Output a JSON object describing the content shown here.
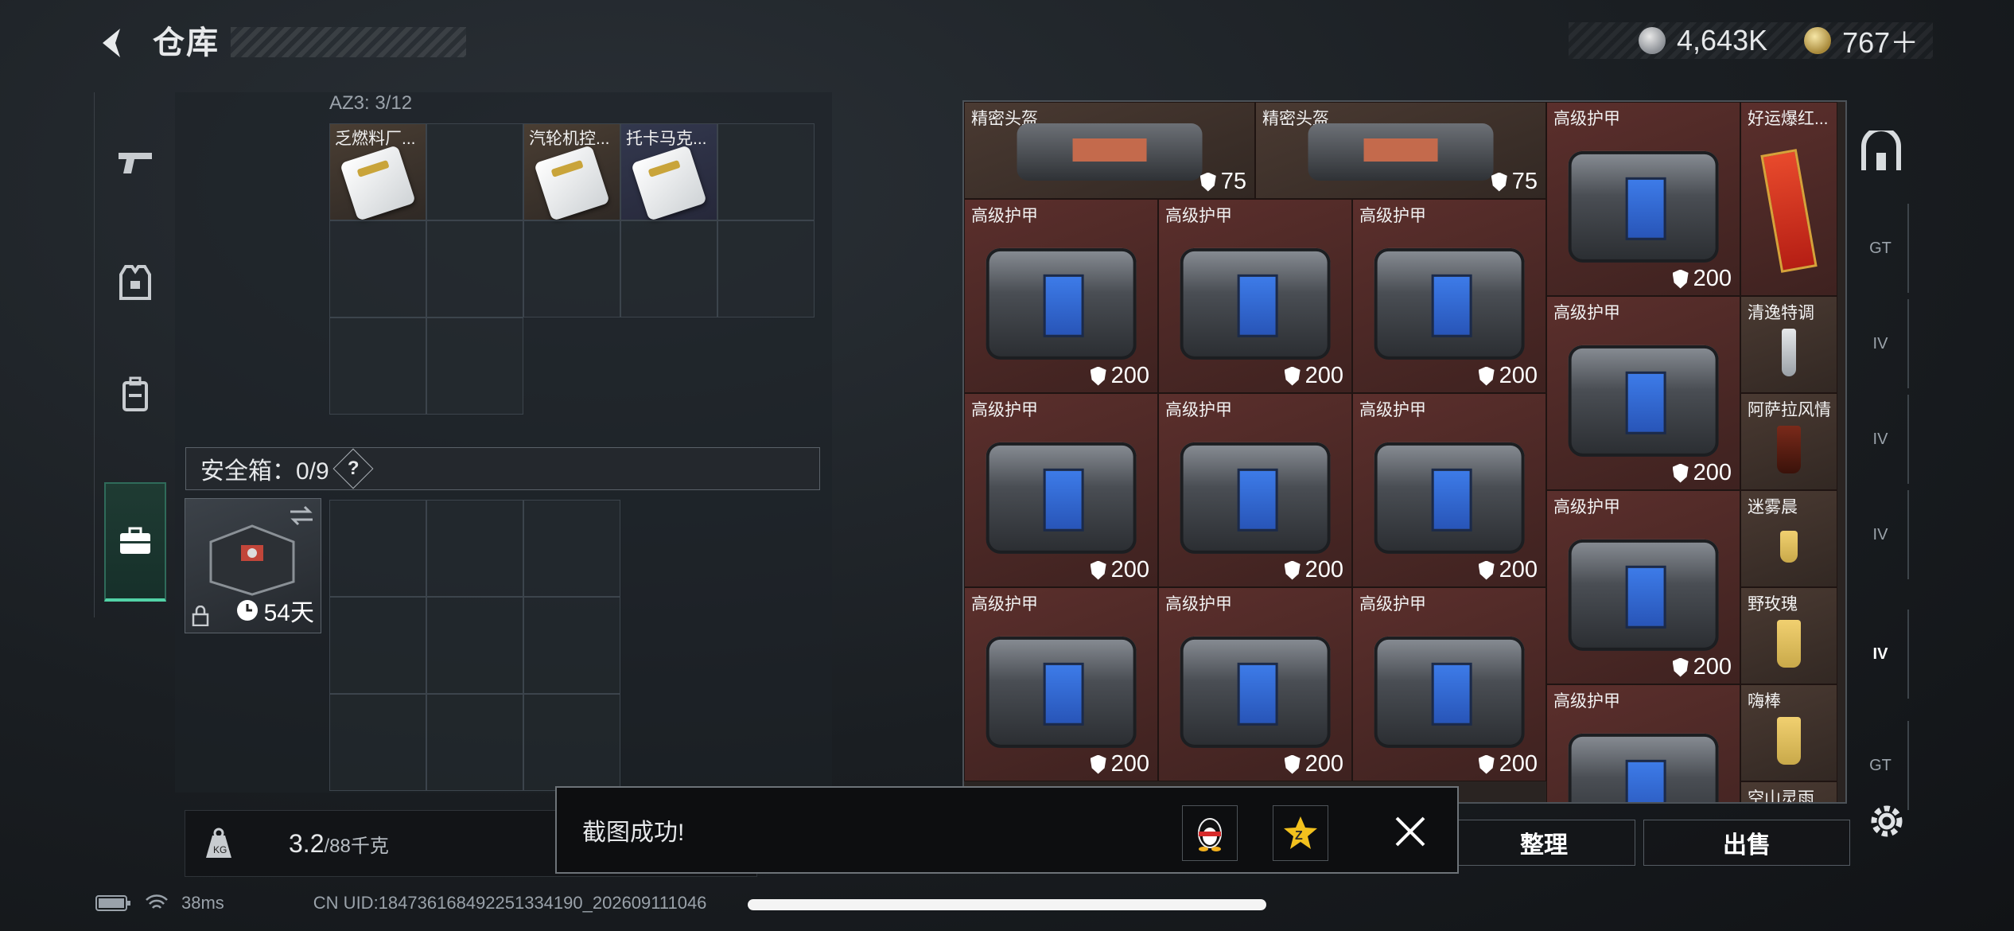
{
  "header": {
    "title": "仓库",
    "currency_silver": "4,643K",
    "currency_gold": "767＋"
  },
  "backpack": {
    "section_label": "AZ3: 3/12",
    "items": [
      {
        "label": "乏燃料厂..."
      },
      {
        "label": "汽轮机控..."
      },
      {
        "label": "托卡马克..."
      }
    ],
    "safe_title": "安全箱：0/9",
    "safe_help": "?",
    "safe_days": "54天",
    "weight_value": "3.2",
    "weight_max": "/88千克"
  },
  "stash": {
    "helmet_name": "精密头盔",
    "helmet_dur": "75",
    "armor_name": "高级护甲",
    "armor_dur": "200",
    "side_items": [
      "好运爆红...",
      "清逸特调",
      "阿萨拉风情",
      "迷雾晨",
      "野玫瑰",
      "嗨棒",
      "空山灵雨"
    ]
  },
  "actions": {
    "sort": "整理",
    "sell": "出售"
  },
  "toast": {
    "message": "截图成功!"
  },
  "status": {
    "ping": "38ms",
    "uid": "CN UID:1847361684922513341​90_202609111046"
  },
  "side_tabs": [
    "GT",
    "IV",
    "IV",
    "IV",
    "IV",
    "GT"
  ]
}
